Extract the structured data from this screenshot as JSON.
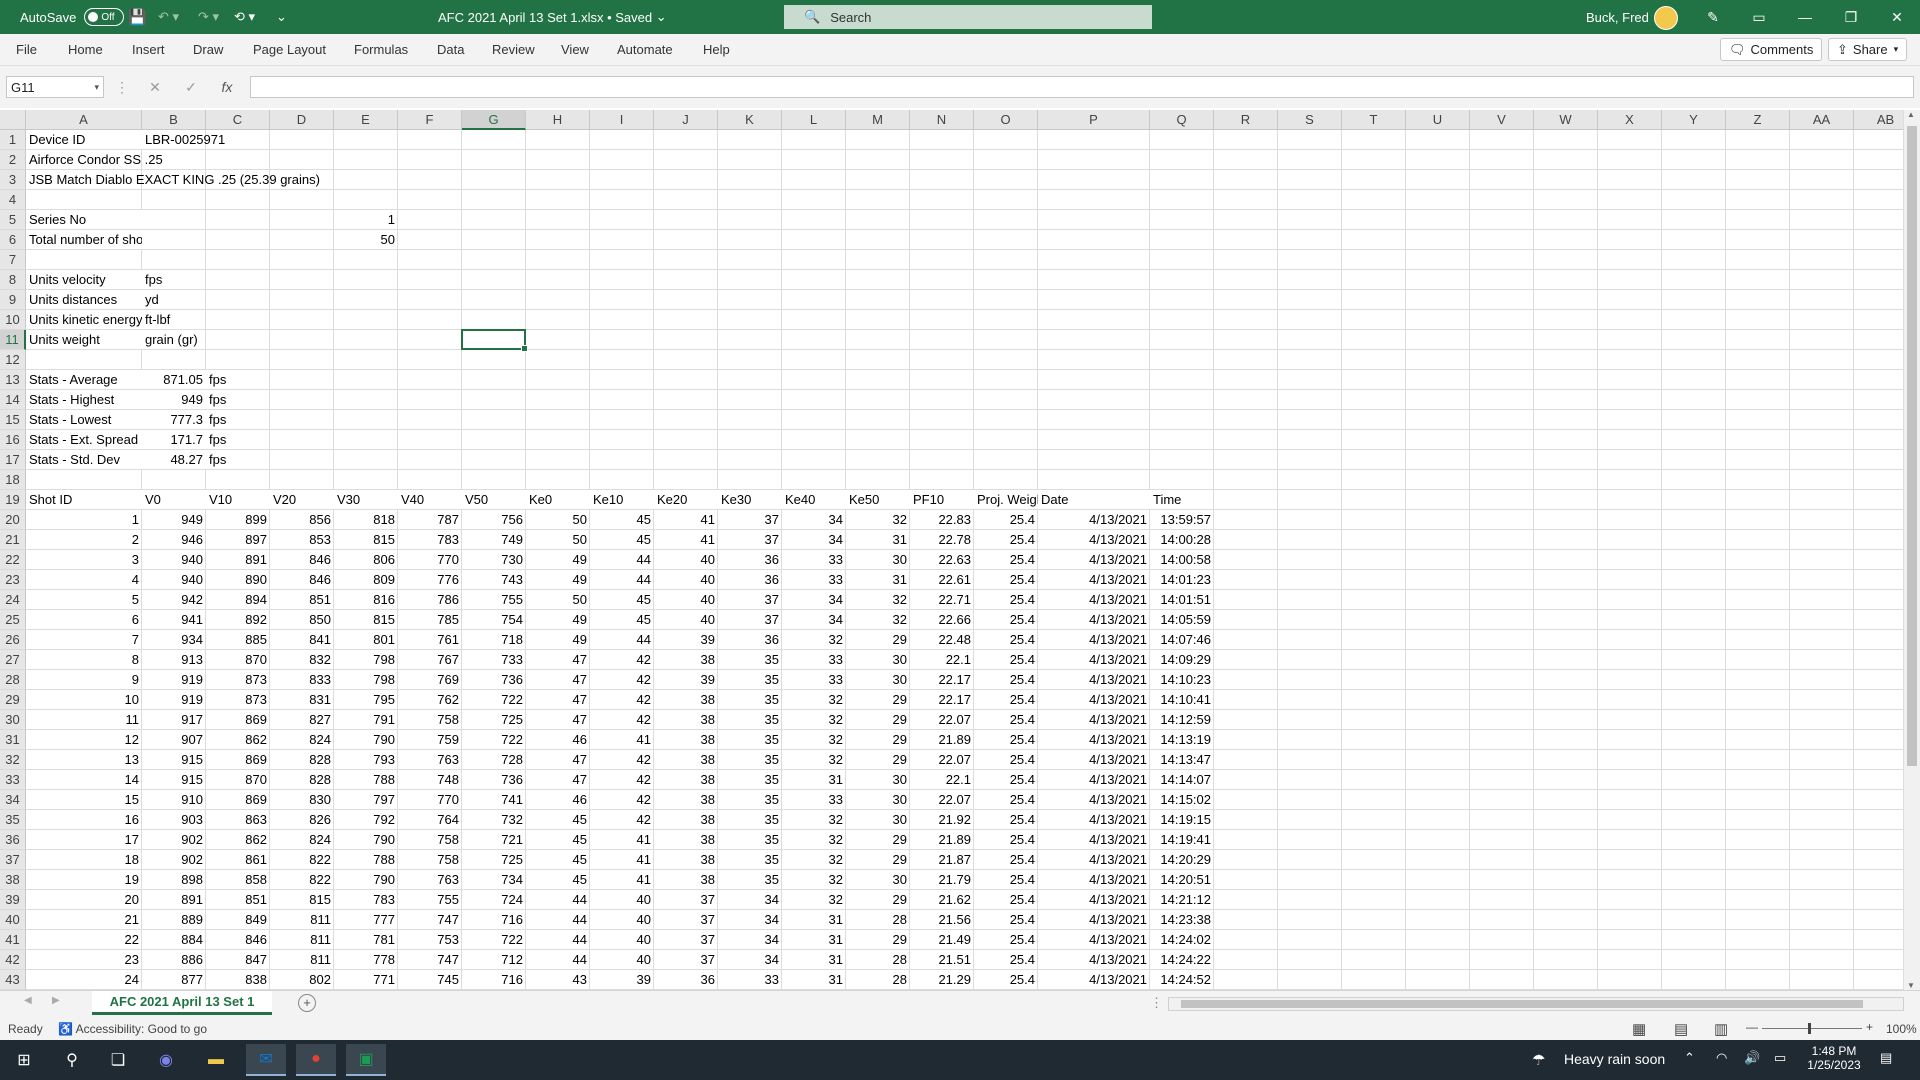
{
  "titlebar": {
    "autosave_label": "AutoSave",
    "autosave_state": "Off",
    "doc_title": "AFC 2021 April 13 Set 1.xlsx • Saved",
    "search_placeholder": "Search",
    "user_name": "Buck, Fred"
  },
  "ribbon": {
    "tabs": [
      "File",
      "Home",
      "Insert",
      "Draw",
      "Page Layout",
      "Formulas",
      "Data",
      "Review",
      "View",
      "Automate",
      "Help"
    ],
    "comments": "Comments",
    "share": "Share"
  },
  "formula_bar": {
    "name_box": "G11",
    "fx": "fx",
    "cancel": "✕",
    "enter": "✓",
    "formula": ""
  },
  "columns": [
    "A",
    "B",
    "C",
    "D",
    "E",
    "F",
    "G",
    "H",
    "I",
    "J",
    "K",
    "L",
    "M",
    "N",
    "O",
    "P",
    "Q",
    "R",
    "S",
    "T",
    "U",
    "V",
    "W",
    "X",
    "Y",
    "Z",
    "AA",
    "AB"
  ],
  "selected_cell": "G11",
  "rows": [
    {
      "n": 1,
      "c": [
        [
          "A",
          "Device ID"
        ],
        [
          "B",
          "LBR-0025971"
        ]
      ]
    },
    {
      "n": 2,
      "c": [
        [
          "A",
          "Airforce Condor SS .25"
        ]
      ]
    },
    {
      "n": 3,
      "c": [
        [
          "A",
          "JSB Match Diablo EXACT KING .25 (25.39 grains)"
        ]
      ]
    },
    {
      "n": 4,
      "c": []
    },
    {
      "n": 5,
      "c": [
        [
          "A",
          "Series No"
        ],
        [
          "B",
          "1"
        ]
      ]
    },
    {
      "n": 6,
      "c": [
        [
          "A",
          "Total number of shots"
        ],
        [
          "B",
          "50"
        ]
      ]
    },
    {
      "n": 7,
      "c": []
    },
    {
      "n": 8,
      "c": [
        [
          "A",
          "Units velocity"
        ],
        [
          "B",
          "fps"
        ]
      ]
    },
    {
      "n": 9,
      "c": [
        [
          "A",
          "Units distances"
        ],
        [
          "B",
          "yd"
        ]
      ]
    },
    {
      "n": 10,
      "c": [
        [
          "A",
          "Units kinetic energy"
        ],
        [
          "B",
          "ft-lbf"
        ]
      ]
    },
    {
      "n": 11,
      "c": [
        [
          "A",
          "Units weight"
        ],
        [
          "B",
          "grain (gr)"
        ]
      ]
    },
    {
      "n": 12,
      "c": []
    },
    {
      "n": 13,
      "c": [
        [
          "A",
          "Stats - Average"
        ],
        [
          "B",
          "871.05"
        ],
        [
          "C",
          "fps"
        ]
      ]
    },
    {
      "n": 14,
      "c": [
        [
          "A",
          "Stats - Highest"
        ],
        [
          "B",
          "949"
        ],
        [
          "C",
          "fps"
        ]
      ]
    },
    {
      "n": 15,
      "c": [
        [
          "A",
          "Stats - Lowest"
        ],
        [
          "B",
          "777.3"
        ],
        [
          "C",
          "fps"
        ]
      ]
    },
    {
      "n": 16,
      "c": [
        [
          "A",
          "Stats - Ext. Spread"
        ],
        [
          "B",
          "171.7"
        ],
        [
          "C",
          "fps"
        ]
      ]
    },
    {
      "n": 17,
      "c": [
        [
          "A",
          "Stats - Std. Dev"
        ],
        [
          "B",
          "48.27"
        ],
        [
          "C",
          "fps"
        ]
      ]
    },
    {
      "n": 18,
      "c": []
    },
    {
      "n": 19,
      "c": [
        [
          "A",
          "Shot ID"
        ],
        [
          "B",
          "V0"
        ],
        [
          "C",
          "V10"
        ],
        [
          "D",
          "V20"
        ],
        [
          "E",
          "V30"
        ],
        [
          "F",
          "V40"
        ],
        [
          "G",
          "V50"
        ],
        [
          "H",
          "Ke0"
        ],
        [
          "I",
          "Ke10"
        ],
        [
          "J",
          "Ke20"
        ],
        [
          "K",
          "Ke30"
        ],
        [
          "L",
          "Ke40"
        ],
        [
          "M",
          "Ke50"
        ],
        [
          "N",
          "PF10"
        ],
        [
          "O",
          "Proj. Weight"
        ],
        [
          "P",
          "Date"
        ],
        [
          "Q",
          "Time"
        ]
      ]
    }
  ],
  "shots": [
    [
      "1",
      "949",
      "899",
      "856",
      "818",
      "787",
      "756",
      "50",
      "45",
      "41",
      "37",
      "34",
      "32",
      "22.83",
      "25.4",
      "4/13/2021",
      "13:59:57"
    ],
    [
      "2",
      "946",
      "897",
      "853",
      "815",
      "783",
      "749",
      "50",
      "45",
      "41",
      "37",
      "34",
      "31",
      "22.78",
      "25.4",
      "4/13/2021",
      "14:00:28"
    ],
    [
      "3",
      "940",
      "891",
      "846",
      "806",
      "770",
      "730",
      "49",
      "44",
      "40",
      "36",
      "33",
      "30",
      "22.63",
      "25.4",
      "4/13/2021",
      "14:00:58"
    ],
    [
      "4",
      "940",
      "890",
      "846",
      "809",
      "776",
      "743",
      "49",
      "44",
      "40",
      "36",
      "33",
      "31",
      "22.61",
      "25.4",
      "4/13/2021",
      "14:01:23"
    ],
    [
      "5",
      "942",
      "894",
      "851",
      "816",
      "786",
      "755",
      "50",
      "45",
      "40",
      "37",
      "34",
      "32",
      "22.71",
      "25.4",
      "4/13/2021",
      "14:01:51"
    ],
    [
      "6",
      "941",
      "892",
      "850",
      "815",
      "785",
      "754",
      "49",
      "45",
      "40",
      "37",
      "34",
      "32",
      "22.66",
      "25.4",
      "4/13/2021",
      "14:05:59"
    ],
    [
      "7",
      "934",
      "885",
      "841",
      "801",
      "761",
      "718",
      "49",
      "44",
      "39",
      "36",
      "32",
      "29",
      "22.48",
      "25.4",
      "4/13/2021",
      "14:07:46"
    ],
    [
      "8",
      "913",
      "870",
      "832",
      "798",
      "767",
      "733",
      "47",
      "42",
      "38",
      "35",
      "33",
      "30",
      "22.1",
      "25.4",
      "4/13/2021",
      "14:09:29"
    ],
    [
      "9",
      "919",
      "873",
      "833",
      "798",
      "769",
      "736",
      "47",
      "42",
      "39",
      "35",
      "33",
      "30",
      "22.17",
      "25.4",
      "4/13/2021",
      "14:10:23"
    ],
    [
      "10",
      "919",
      "873",
      "831",
      "795",
      "762",
      "722",
      "47",
      "42",
      "38",
      "35",
      "32",
      "29",
      "22.17",
      "25.4",
      "4/13/2021",
      "14:10:41"
    ],
    [
      "11",
      "917",
      "869",
      "827",
      "791",
      "758",
      "725",
      "47",
      "42",
      "38",
      "35",
      "32",
      "29",
      "22.07",
      "25.4",
      "4/13/2021",
      "14:12:59"
    ],
    [
      "12",
      "907",
      "862",
      "824",
      "790",
      "759",
      "722",
      "46",
      "41",
      "38",
      "35",
      "32",
      "29",
      "21.89",
      "25.4",
      "4/13/2021",
      "14:13:19"
    ],
    [
      "13",
      "915",
      "869",
      "828",
      "793",
      "763",
      "728",
      "47",
      "42",
      "38",
      "35",
      "32",
      "29",
      "22.07",
      "25.4",
      "4/13/2021",
      "14:13:47"
    ],
    [
      "14",
      "915",
      "870",
      "828",
      "788",
      "748",
      "736",
      "47",
      "42",
      "38",
      "35",
      "31",
      "30",
      "22.1",
      "25.4",
      "4/13/2021",
      "14:14:07"
    ],
    [
      "15",
      "910",
      "869",
      "830",
      "797",
      "770",
      "741",
      "46",
      "42",
      "38",
      "35",
      "33",
      "30",
      "22.07",
      "25.4",
      "4/13/2021",
      "14:15:02"
    ],
    [
      "16",
      "903",
      "863",
      "826",
      "792",
      "764",
      "732",
      "45",
      "42",
      "38",
      "35",
      "32",
      "30",
      "21.92",
      "25.4",
      "4/13/2021",
      "14:19:15"
    ],
    [
      "17",
      "902",
      "862",
      "824",
      "790",
      "758",
      "721",
      "45",
      "41",
      "38",
      "35",
      "32",
      "29",
      "21.89",
      "25.4",
      "4/13/2021",
      "14:19:41"
    ],
    [
      "18",
      "902",
      "861",
      "822",
      "788",
      "758",
      "725",
      "45",
      "41",
      "38",
      "35",
      "32",
      "29",
      "21.87",
      "25.4",
      "4/13/2021",
      "14:20:29"
    ],
    [
      "19",
      "898",
      "858",
      "822",
      "790",
      "763",
      "734",
      "45",
      "41",
      "38",
      "35",
      "32",
      "30",
      "21.79",
      "25.4",
      "4/13/2021",
      "14:20:51"
    ],
    [
      "20",
      "891",
      "851",
      "815",
      "783",
      "755",
      "724",
      "44",
      "40",
      "37",
      "34",
      "32",
      "29",
      "21.62",
      "25.4",
      "4/13/2021",
      "14:21:12"
    ],
    [
      "21",
      "889",
      "849",
      "811",
      "777",
      "747",
      "716",
      "44",
      "40",
      "37",
      "34",
      "31",
      "28",
      "21.56",
      "25.4",
      "4/13/2021",
      "14:23:38"
    ],
    [
      "22",
      "884",
      "846",
      "811",
      "781",
      "753",
      "722",
      "44",
      "40",
      "37",
      "34",
      "31",
      "29",
      "21.49",
      "25.4",
      "4/13/2021",
      "14:24:02"
    ],
    [
      "23",
      "886",
      "847",
      "811",
      "778",
      "747",
      "712",
      "44",
      "40",
      "37",
      "34",
      "31",
      "28",
      "21.51",
      "25.4",
      "4/13/2021",
      "14:24:22"
    ],
    [
      "24",
      "877",
      "838",
      "802",
      "771",
      "745",
      "716",
      "43",
      "39",
      "36",
      "33",
      "31",
      "28",
      "21.29",
      "25.4",
      "4/13/2021",
      "14:24:52"
    ]
  ],
  "sheet_tab": "AFC 2021 April 13 Set 1",
  "status": {
    "ready": "Ready",
    "accessibility": "Accessibility: Good to go",
    "zoom": "100%"
  },
  "taskbar": {
    "weather": "Heavy rain soon",
    "time": "1:48 PM",
    "date": "1/25/2023"
  },
  "colors": {
    "accent": "#217346",
    "taskbar": "#1f2a33"
  }
}
